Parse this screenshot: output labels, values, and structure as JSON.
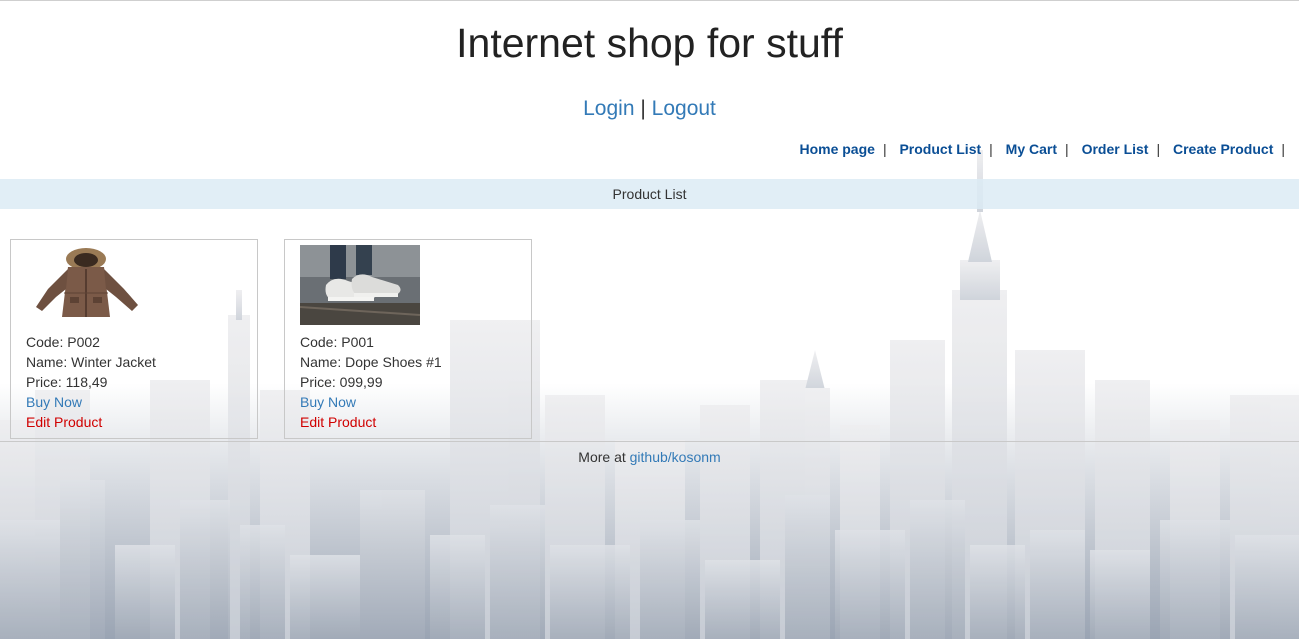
{
  "site": {
    "title": "Internet shop for stuff"
  },
  "auth": {
    "login": "Login",
    "separator": "|",
    "logout": "Logout"
  },
  "nav": {
    "items": [
      {
        "label": "Home page"
      },
      {
        "label": "Product List"
      },
      {
        "label": "My Cart"
      },
      {
        "label": "Order List"
      },
      {
        "label": "Create Product"
      }
    ],
    "separator": "|"
  },
  "page": {
    "heading": "Product List"
  },
  "products": [
    {
      "code": "Code: P002",
      "name": "Name: Winter Jacket",
      "price": "Price: 118,49",
      "buy": "Buy Now",
      "edit": "Edit Product",
      "image": "jacket-image"
    },
    {
      "code": "Code: P001",
      "name": "Name: Dope Shoes #1",
      "price": "Price: 099,99",
      "buy": "Buy Now",
      "edit": "Edit Product",
      "image": "shoes-image"
    }
  ],
  "footer": {
    "prefix": "More at",
    "link": "github/kosonm"
  },
  "colors": {
    "link": "#337ab7",
    "nav_link": "#0a4e95",
    "edit": "#d00000",
    "subbar": "#dcebf5"
  }
}
